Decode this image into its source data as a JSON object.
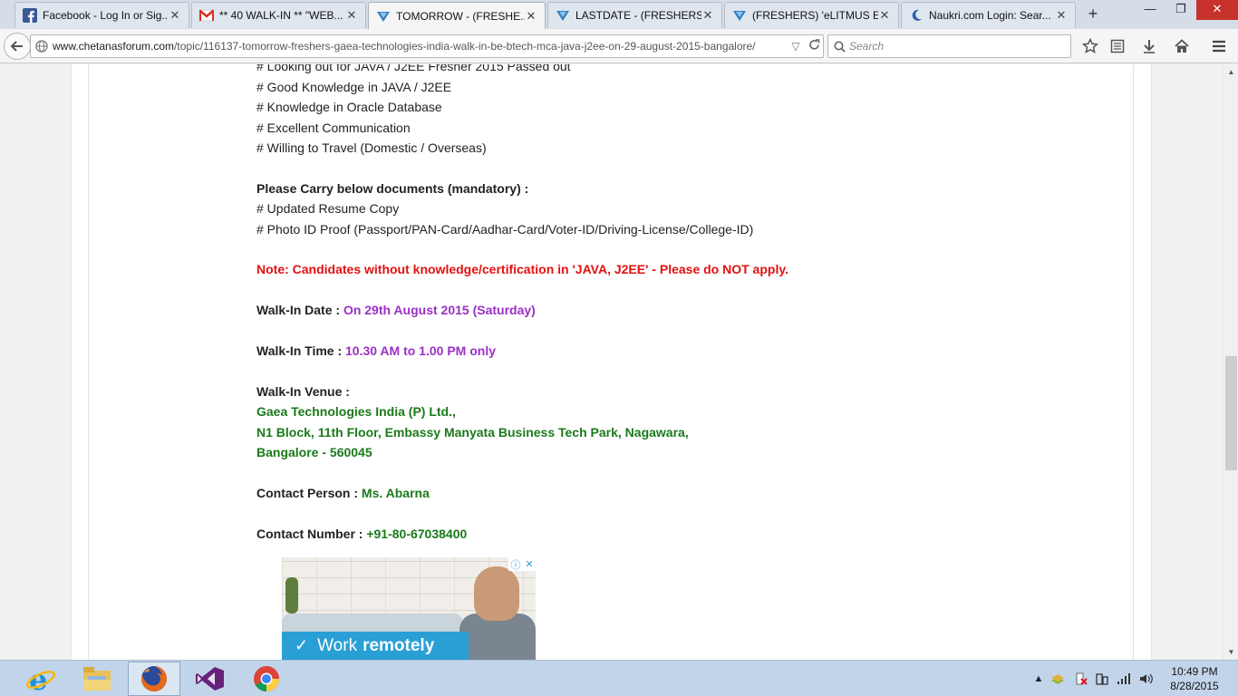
{
  "tabs": [
    {
      "label": "Facebook - Log In or Sig...",
      "icon": "facebook-icon",
      "active": false
    },
    {
      "label": "** 40 WALK-IN ** \"WEB...",
      "icon": "gmail-icon",
      "active": false
    },
    {
      "label": "TOMORROW - (FRESHE...",
      "icon": "chetanas-icon",
      "active": true
    },
    {
      "label": "LASTDATE - (FRESHERS ...",
      "icon": "chetanas-icon",
      "active": false
    },
    {
      "label": "(FRESHERS) 'eLITMUS E...",
      "icon": "chetanas-icon",
      "active": false
    },
    {
      "label": "Naukri.com Login: Sear...",
      "icon": "naukri-icon",
      "active": false
    }
  ],
  "tab_close_glyph": "✕",
  "newtab_glyph": "+",
  "window": {
    "minimize": "—",
    "restore": "❐",
    "close": "✕"
  },
  "nav": {
    "url_host": "www.chetanasforum.com",
    "url_path": "/topic/116137-tomorrow-freshers-gaea-technologies-india-walk-in-be-btech-mca-java-j2ee-on-29-august-2015-bangalore/",
    "search_placeholder": "Search"
  },
  "post": {
    "req_1": "# Looking out for JAVA / J2EE Fresher 2015 Passed out",
    "req_2": "# Good Knowledge in JAVA / J2EE",
    "req_3": "# Knowledge in Oracle Database",
    "req_4": "# Excellent Communication",
    "req_5": "# Willing to Travel (Domestic / Overseas)",
    "docs_heading": "Please Carry below documents (mandatory) :",
    "doc_1": "# Updated Resume Copy",
    "doc_2": "# Photo ID Proof (Passport/PAN-Card/Aadhar-Card/Voter-ID/Driving-License/College-ID)",
    "note": "Note: Candidates without knowledge/certification in 'JAVA, J2EE' - Please do NOT apply.",
    "date_label": "Walk-In Date : ",
    "date_value": "On 29th August 2015 (Saturday)",
    "time_label": "Walk-In Time : ",
    "time_value": "10.30 AM to 1.00 PM only",
    "venue_label": "Walk-In Venue :",
    "venue_1": "Gaea Technologies India (P) Ltd.,",
    "venue_2": "N1 Block, 11th Floor, Embassy Manyata Business Tech Park, Nagawara,",
    "venue_3": "Bangalore - 560045",
    "contact_label": "Contact Person : ",
    "contact_value": "Ms. Abarna",
    "number_label": "Contact Number : ",
    "number_value": "+91-80-67038400"
  },
  "ad": {
    "text_regular": "Work",
    "text_bold": "remotely",
    "check_glyph": "✓",
    "info_glyph": "ⓘ",
    "close_glyph": "✕"
  },
  "scrollbar": {
    "up_glyph": "▲",
    "down_glyph": "▼"
  },
  "taskbar": {
    "apps": [
      "internet-explorer",
      "file-explorer",
      "firefox",
      "visual-studio",
      "chrome"
    ],
    "active_app": "firefox",
    "time": "10:49 PM",
    "date": "8/28/2015"
  },
  "colors": {
    "note": "#e31010",
    "highlight": "#9b30c7",
    "venue": "#1a7a1a",
    "ad_banner": "#2a9fd6"
  }
}
